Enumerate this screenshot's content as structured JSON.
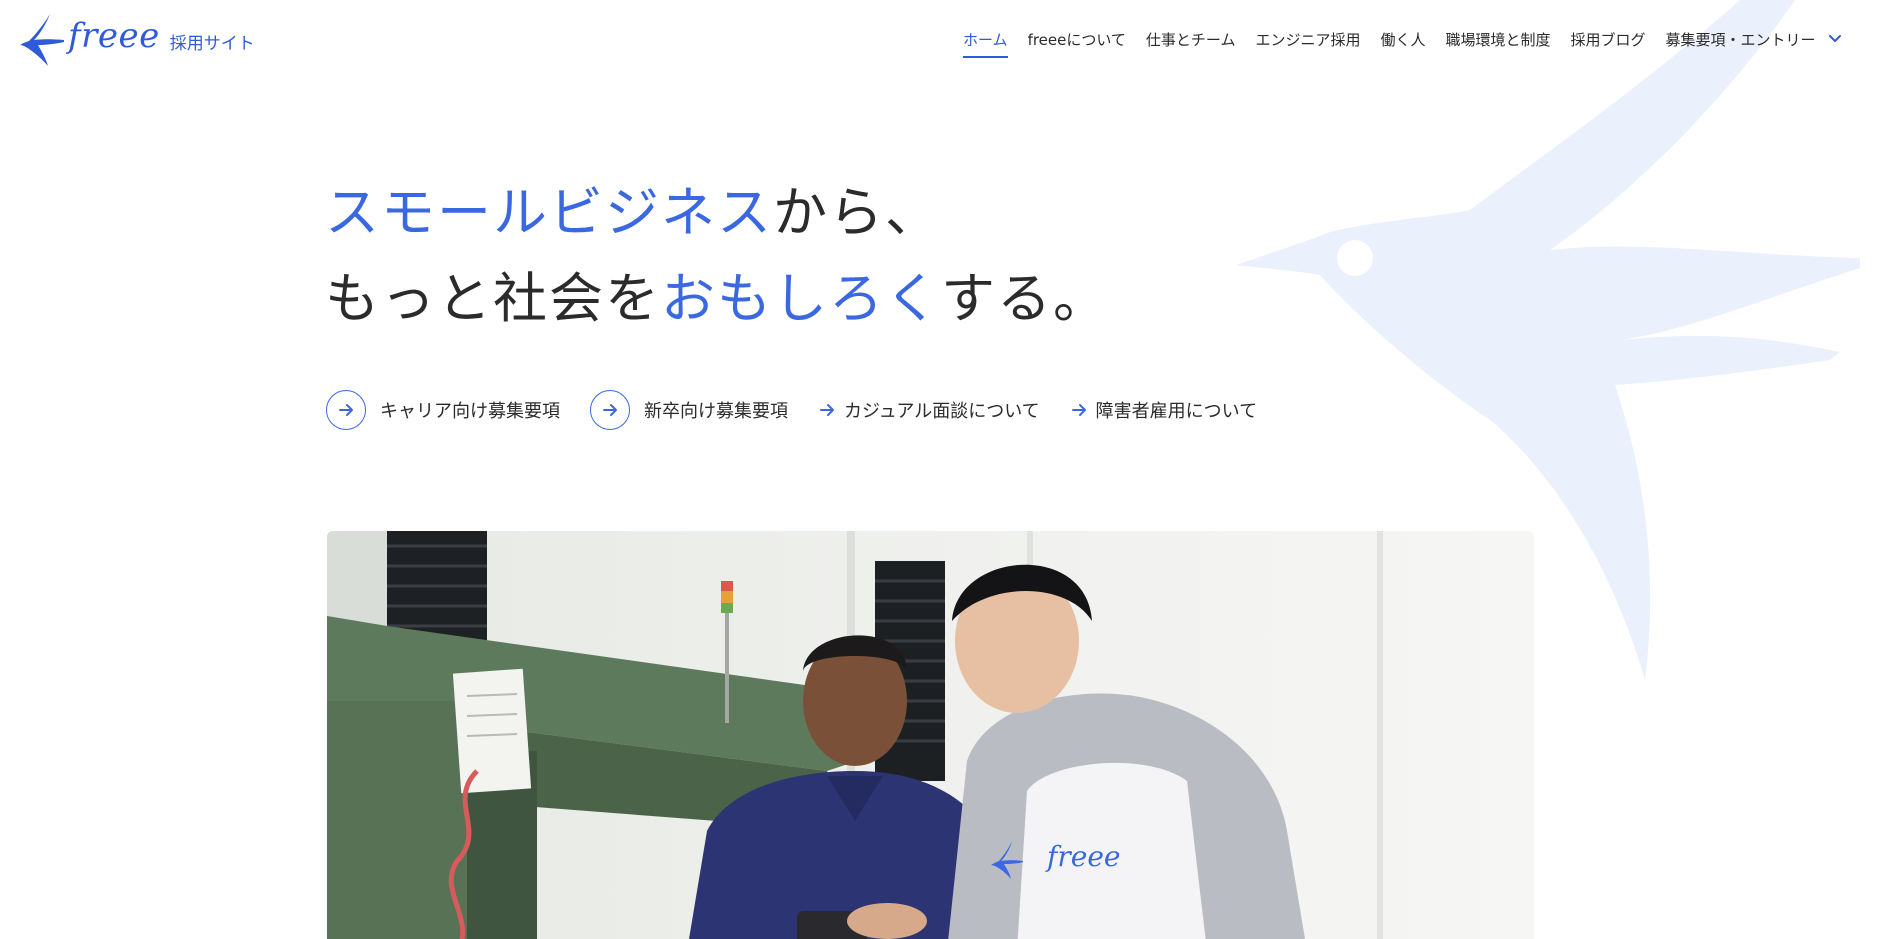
{
  "header": {
    "logo_text": "freee",
    "logo_sub": "採用サイト",
    "nav": [
      {
        "label": "ホーム",
        "active": true
      },
      {
        "label": "freeeについて"
      },
      {
        "label": "仕事とチーム"
      },
      {
        "label": "エンジニア採用"
      },
      {
        "label": "働く人"
      },
      {
        "label": "職場環境と制度"
      },
      {
        "label": "採用ブログ"
      },
      {
        "label": "募集要項・エントリー",
        "dropdown": true
      }
    ]
  },
  "hero": {
    "line1_accent": "スモールビジネス",
    "line1_rest": "から、",
    "line2_pre": "もっと社会を",
    "line2_accent": "おもしろく",
    "line2_post": "する。"
  },
  "links": [
    {
      "label": "キャリア向け募集要項",
      "style": "circle"
    },
    {
      "label": "新卒向け募集要項",
      "style": "circle"
    },
    {
      "label": "カジュアル面談について",
      "style": "plain"
    },
    {
      "label": "障害者雇用について",
      "style": "plain"
    }
  ],
  "photo": {
    "shirt_logo": "freee"
  },
  "colors": {
    "accent": "#3a68e0",
    "text": "#2b2b2b",
    "bird_bg": "#eaf0fc"
  }
}
